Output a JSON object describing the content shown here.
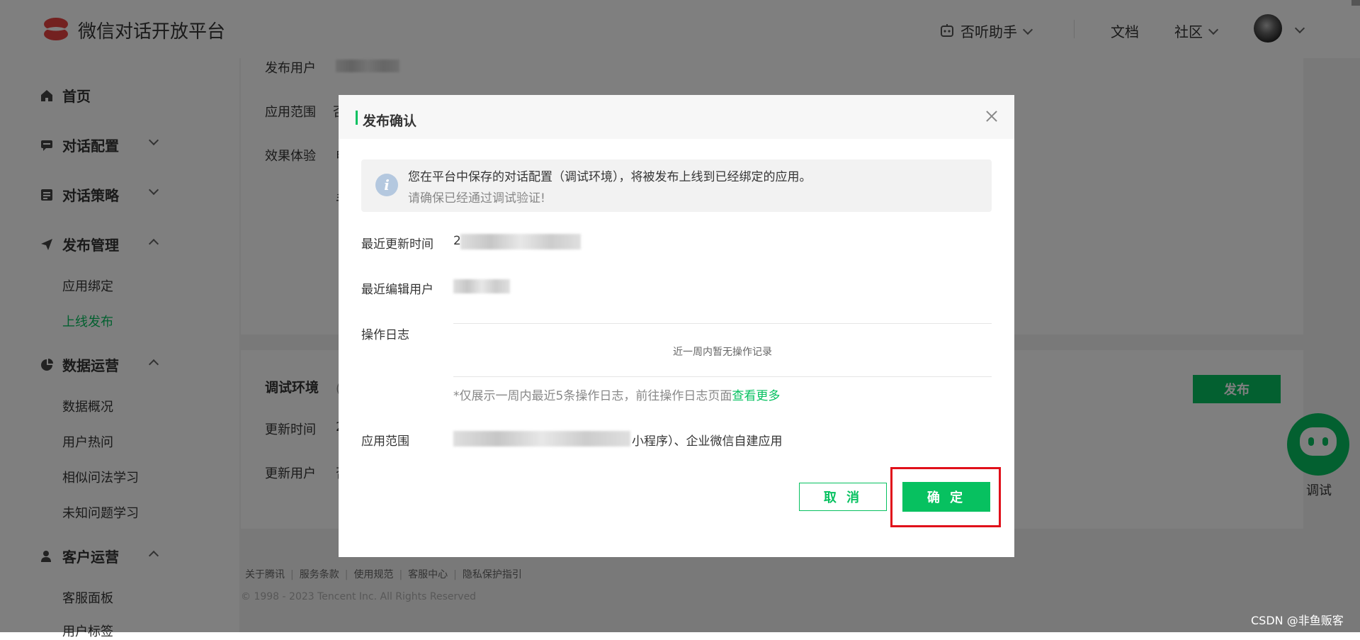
{
  "header": {
    "brand": "微信对话开放平台",
    "assistant": "否听助手",
    "docs": "文档",
    "community": "社区"
  },
  "sidebar": {
    "home": "首页",
    "dialog_config": "对话配置",
    "dialog_strategy": "对话策略",
    "publish_mgmt": "发布管理",
    "publish_sub": [
      "应用绑定",
      "上线发布"
    ],
    "data_ops": "数据运营",
    "data_sub": [
      "数据概况",
      "用户热问",
      "相似问法学习",
      "未知问题学习"
    ],
    "customer_ops": "客户运营",
    "customer_sub": [
      "客服面板",
      "用户标签"
    ]
  },
  "main": {
    "top_card": {
      "publisher_label": "发布用户",
      "scope_label": "应用范围",
      "scope_value_prefix": "否",
      "effect_label": "效果体验",
      "effect_value_prefix": "申",
      "extra_prefix": "手"
    },
    "debug_card": {
      "title": "调试环境",
      "title_suffix": "(完",
      "update_time_label": "更新时间",
      "update_time_prefix": "2",
      "update_user_label": "更新用户",
      "update_user_prefix": "否",
      "publish_button": "发布"
    },
    "bot_label": "调试",
    "footer_links": [
      "关于腾讯",
      "服务条款",
      "使用规范",
      "客服中心",
      "隐私保护指引"
    ],
    "copyright": "© 1998 - 2023 Tencent Inc. All Rights Reserved"
  },
  "dialog": {
    "title": "发布确认",
    "notice_line1": "您在平台中保存的对话配置（调试环境），将被发布上线到已经绑定的应用。",
    "notice_line2": "请确保已经通过调试验证!",
    "last_update_label": "最近更新时间",
    "last_update_prefix": "2",
    "last_editor_label": "最近编辑用户",
    "log_label": "操作日志",
    "log_empty": "近一周内暂无操作记录",
    "log_note": "*仅展示一周内最近5条操作日志，前往操作日志页面",
    "log_more_link": "查看更多",
    "scope_label": "应用范围",
    "scope_value": "小程序）、企业微信自建应用",
    "cancel": "取 消",
    "confirm": "确 定"
  },
  "watermark": "CSDN @非鱼贩客",
  "colors": {
    "accent": "#07c160",
    "highlight": "#e0101a"
  }
}
